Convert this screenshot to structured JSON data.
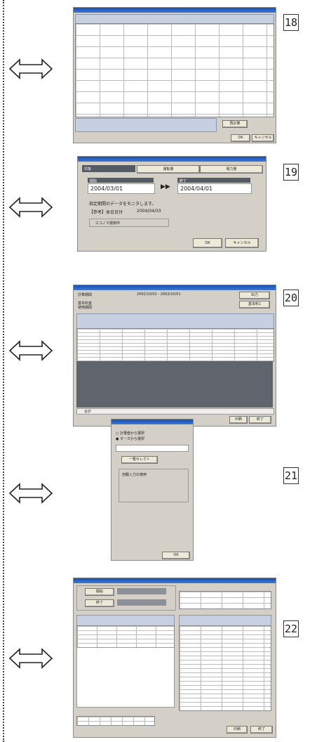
{
  "steps": [
    {
      "num": "18"
    },
    {
      "num": "19"
    },
    {
      "num": "20"
    },
    {
      "num": "21"
    },
    {
      "num": "22"
    }
  ],
  "screen19": {
    "tab_left": "対象",
    "tab_mid": "運転量",
    "tab_right": "電力量",
    "from_label": "開始",
    "from_date": "2004/03/01",
    "to_label": "終了",
    "to_date": "2004/04/01",
    "desc": "指定期間のデータをモニタします。",
    "ref": "【参考】本日日付",
    "ref_date": "2004/04/03",
    "checkbox_label": "エコノマ運用中",
    "ok": "OK",
    "cancel": "キャンセル"
  },
  "screen20": {
    "label1": "計算期間",
    "label2": "基本料金",
    "label3": "使用期間",
    "period": "2002/10/01 - 2002/10/01",
    "btn1": "出力",
    "btn2": "基本料1",
    "print": "印刷",
    "close": "終了",
    "total": "合計"
  },
  "screen21": {
    "radio1": "計量値から選択",
    "radio2": "ターカから選択",
    "select_btn": "一覧セレクト",
    "check": "自動入力の使用",
    "ok": "OK"
  },
  "screen22": {
    "btn_a": "開始",
    "btn_b": "終了",
    "print": "印刷",
    "close": "終了"
  },
  "screen18": {
    "ok": "OK",
    "cancel": "キャンセル",
    "calc": "再計算"
  }
}
